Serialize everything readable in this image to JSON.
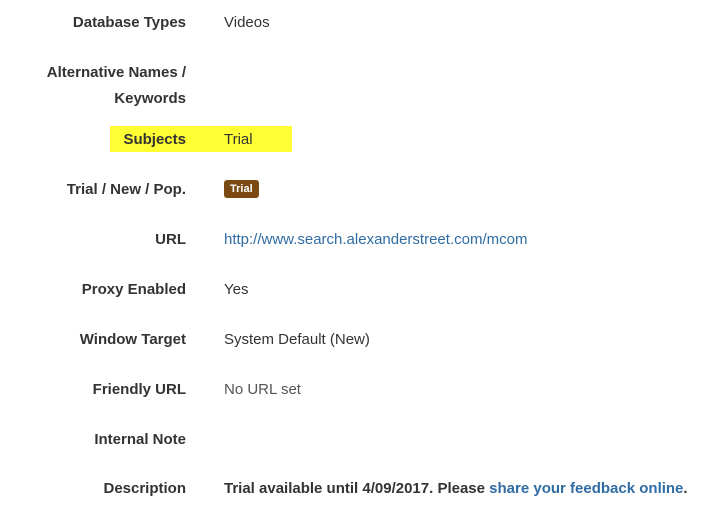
{
  "fields": {
    "database_types": {
      "label": "Database Types",
      "value": "Videos"
    },
    "alt_names": {
      "label_line1": "Alternative Names /",
      "label_line2": "Keywords",
      "value": ""
    },
    "subjects": {
      "label": "Subjects",
      "value": "Trial"
    },
    "trial_new_pop": {
      "label": "Trial / New / Pop.",
      "badge": "Trial"
    },
    "url": {
      "label": "URL",
      "value": "http://www.search.alexanderstreet.com/mcom"
    },
    "proxy_enabled": {
      "label": "Proxy Enabled",
      "value": "Yes"
    },
    "window_target": {
      "label": "Window Target",
      "value": "System Default (New)"
    },
    "friendly_url": {
      "label": "Friendly URL",
      "value": "No URL set"
    },
    "internal_note": {
      "label": "Internal Note",
      "value": ""
    },
    "description": {
      "label": "Description",
      "text_before": "Trial available until 4/09/2017. Please ",
      "link_text": "share your feedback online",
      "text_after": "."
    }
  },
  "colors": {
    "highlight": "#ffff33",
    "badge_bg": "#7a4a12",
    "link": "#2f6ca3"
  }
}
